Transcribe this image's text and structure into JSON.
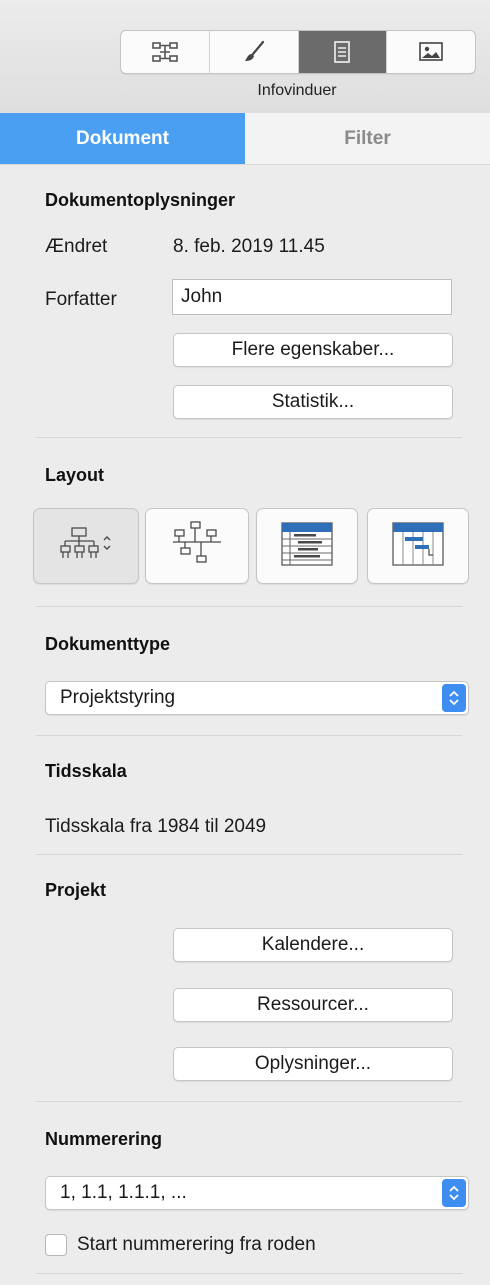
{
  "toolbar": {
    "caption": "Infovinduer",
    "segments": [
      {
        "icon": "outline-structure-icon",
        "active": false
      },
      {
        "icon": "style-brush-icon",
        "active": false
      },
      {
        "icon": "document-icon",
        "active": true
      },
      {
        "icon": "image-icon",
        "active": false
      }
    ]
  },
  "tabs": [
    {
      "label": "Dokument",
      "active": true
    },
    {
      "label": "Filter",
      "active": false
    }
  ],
  "document_info": {
    "heading": "Dokumentoplysninger",
    "modified_label": "Ændret",
    "modified_value": "8. feb. 2019 11.45",
    "author_label": "Forfatter",
    "author_value": "John",
    "more_properties_button": "Flere egenskaber...",
    "statistics_button": "Statistik..."
  },
  "layout": {
    "heading": "Layout",
    "buttons": [
      {
        "icon": "org-chart-icon",
        "has_dropdown": true
      },
      {
        "icon": "timeline-chart-icon",
        "has_dropdown": false
      },
      {
        "icon": "table-outline-icon",
        "has_dropdown": false
      },
      {
        "icon": "gantt-chart-icon",
        "has_dropdown": false
      }
    ]
  },
  "document_type": {
    "heading": "Dokumenttype",
    "selected": "Projektstyring"
  },
  "timescale": {
    "heading": "Tidsskala",
    "text": "Tidsskala fra 1984 til 2049"
  },
  "project": {
    "heading": "Projekt",
    "calendars_button": "Kalendere...",
    "resources_button": "Ressourcer...",
    "info_button": "Oplysninger..."
  },
  "numbering": {
    "heading": "Nummerering",
    "selected": "1, 1.1, 1.1.1, ...",
    "checkbox_label": "Start nummerering fra roden",
    "checkbox_checked": false
  },
  "colors": {
    "accent": "#4a9ff2",
    "popup_stepper": "#3d8ef0"
  }
}
